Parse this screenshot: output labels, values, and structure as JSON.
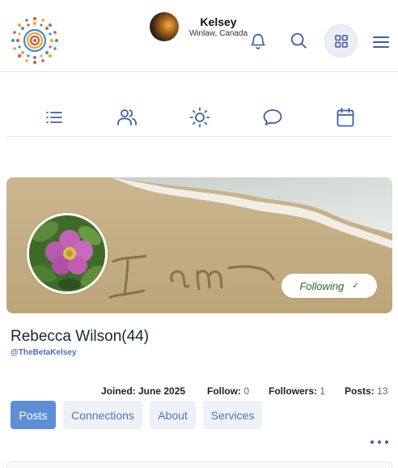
{
  "header": {
    "user": {
      "name": "Kelsey",
      "location": "Winlaw, Canada"
    },
    "icons": [
      "notification-bell-icon",
      "search-icon",
      "apps-grid-icon",
      "hamburger-menu-icon"
    ]
  },
  "nav_icons": [
    "list-icon",
    "people-icon",
    "sun-icon",
    "chat-bubble-icon",
    "calendar-icon"
  ],
  "profile": {
    "name": "Rebecca Wilson(44)",
    "handle": "@TheBetaKelsey",
    "follow_button": "Following",
    "follow_check": "✓",
    "cover_text": "I am",
    "stats": {
      "joined_label": "Joined: June 2025",
      "follow_label": "Follow:",
      "follow_value": "0",
      "followers_label": "Followers:",
      "followers_value": "1",
      "posts_label": "Posts:",
      "posts_value": "13"
    },
    "tabs": [
      {
        "label": "Posts",
        "active": true
      },
      {
        "label": "Connections",
        "active": false
      },
      {
        "label": "About",
        "active": false
      },
      {
        "label": "Services",
        "active": false
      }
    ]
  },
  "colors": {
    "accent": "#5c8fd6",
    "tab_inactive_bg": "#eef1f6",
    "tab_inactive_text": "#4a78c2",
    "icon": "#3b5ea8",
    "following_text": "#2e6b1f",
    "handle": "#4a6fb5"
  }
}
